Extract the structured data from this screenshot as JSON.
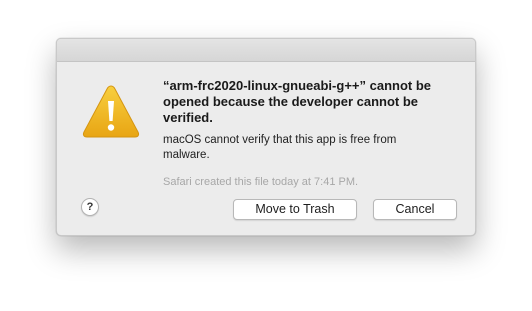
{
  "dialog": {
    "title": "“arm-frc2020-linux-gnueabi-g++” cannot be opened because the developer cannot be verified.",
    "message": "macOS cannot verify that this app is free from malware.",
    "info": "Safari created this file today at 7:41 PM.",
    "help_label": "?",
    "buttons": {
      "move_to_trash": "Move to Trash",
      "cancel": "Cancel"
    },
    "icon": "warning-icon"
  },
  "colors": {
    "warning_yellow": "#f2b61d",
    "dialog_bg": "#ececec",
    "info_text": "#a7a7a7"
  }
}
